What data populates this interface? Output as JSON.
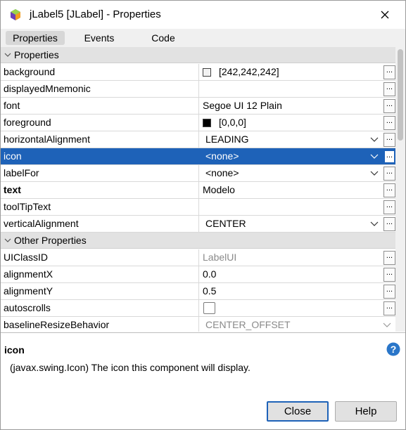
{
  "window": {
    "title": "jLabel5 [JLabel] - Properties",
    "accent": "#1e62b8"
  },
  "tabs": [
    {
      "label": "Properties",
      "active": true
    },
    {
      "label": "Events",
      "active": false
    },
    {
      "label": "Code",
      "active": false
    }
  ],
  "categories": {
    "properties": "Properties",
    "other": "Other Properties"
  },
  "properties": [
    {
      "name": "background",
      "value": "[242,242,242]",
      "swatch": "#f2f2f2"
    },
    {
      "name": "displayedMnemonic",
      "value": ""
    },
    {
      "name": "font",
      "value": "Segoe UI 12 Plain"
    },
    {
      "name": "foreground",
      "value": "[0,0,0]",
      "swatch": "#000000"
    },
    {
      "name": "horizontalAlignment",
      "value": "LEADING",
      "dropdown": true
    },
    {
      "name": "icon",
      "value": "<none>",
      "dropdown": true,
      "selected": true
    },
    {
      "name": "labelFor",
      "value": "<none>",
      "dropdown": true
    },
    {
      "name": "text",
      "value": "Modelo",
      "bold": true
    },
    {
      "name": "toolTipText",
      "value": ""
    },
    {
      "name": "verticalAlignment",
      "value": "CENTER",
      "dropdown": true
    }
  ],
  "other_properties": [
    {
      "name": "UIClassID",
      "value": "LabelUI",
      "disabled": true
    },
    {
      "name": "alignmentX",
      "value": "0.0"
    },
    {
      "name": "alignmentY",
      "value": "0.5"
    },
    {
      "name": "autoscrolls",
      "value": "",
      "checkbox": true,
      "checked": false
    },
    {
      "name": "baselineResizeBehavior",
      "value": "CENTER_OFFSET",
      "dropdown": true,
      "disabled": true
    }
  ],
  "ellipsis_label": "...",
  "description": {
    "title": "icon",
    "text": "(javax.swing.Icon) The icon this component will display."
  },
  "buttons": {
    "close": "Close",
    "help": "Help"
  }
}
